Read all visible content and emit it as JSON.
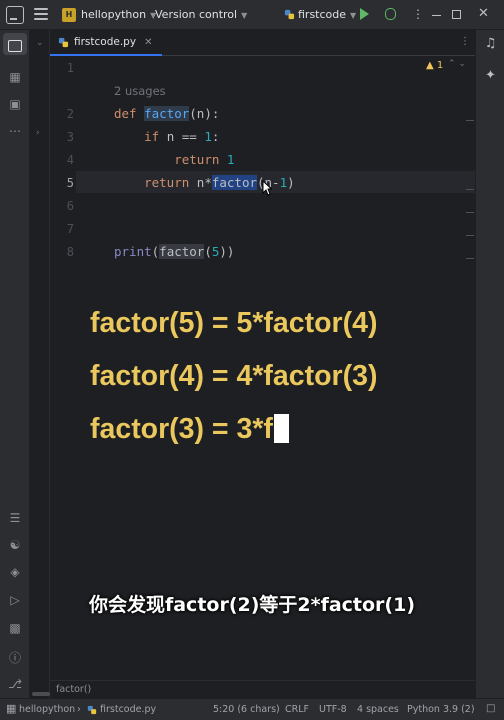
{
  "titlebar": {
    "project_badge": "H",
    "project_name": "hellopython",
    "version_control": "Version control",
    "run_config": "firstcode"
  },
  "tab": {
    "label": "firstcode.py"
  },
  "editor": {
    "usages_hint": "2 usages",
    "warning_count": "1",
    "line_numbers": [
      "1",
      "2",
      "3",
      "4",
      "5",
      "6",
      "7",
      "8"
    ]
  },
  "code": {
    "def_kw": "def",
    "func_name": "factor",
    "def_params": "(n):",
    "if_kw": "if",
    "if_cond_a": " n == ",
    "if_num": "1",
    "if_colon": ":",
    "return_kw": "return",
    "return_one": "1",
    "ret2_expr_a": " n*",
    "ret2_call": "factor",
    "ret2_args_a": "(n-",
    "ret2_num": "1",
    "ret2_args_b": ")",
    "print_fn": "print",
    "print_open": "(",
    "print_call": "factor",
    "print_arg_open": "(",
    "print_num": "5",
    "print_close": "))"
  },
  "overlay": {
    "line1": "factor(5) = 5*factor(4)",
    "line2": "factor(4) = 4*factor(3)",
    "line3": "factor(3) = 3*f",
    "subtitle": "你会发现factor(2)等于2*factor(1)",
    "caption_color": "#ebc85e"
  },
  "breadcrumb": "factor()",
  "statusbar": {
    "project": "hellopython",
    "file": "firstcode.py",
    "position": "5:20 (6 chars)",
    "line_sep": "CRLF",
    "encoding": "UTF-8",
    "indent": "4 spaces",
    "interpreter": "Python 3.9 (2)"
  },
  "icons": {
    "titlebar": [
      "app-logo-icon",
      "hamburger-menu-icon",
      "python-icon",
      "run-icon",
      "debug-icon",
      "more-icon",
      "minimize-icon",
      "maximize-icon",
      "close-icon"
    ],
    "left_strip": [
      "project-folder-icon",
      "structure-icon",
      "bookmarks-icon",
      "more-tools-icon",
      "todo-icon",
      "python-packages-icon",
      "layers-icon",
      "services-icon",
      "terminal-icon",
      "problems-icon",
      "git-icon"
    ],
    "right_strip": [
      "notifications-icon",
      "ai-assistant-icon"
    ]
  }
}
